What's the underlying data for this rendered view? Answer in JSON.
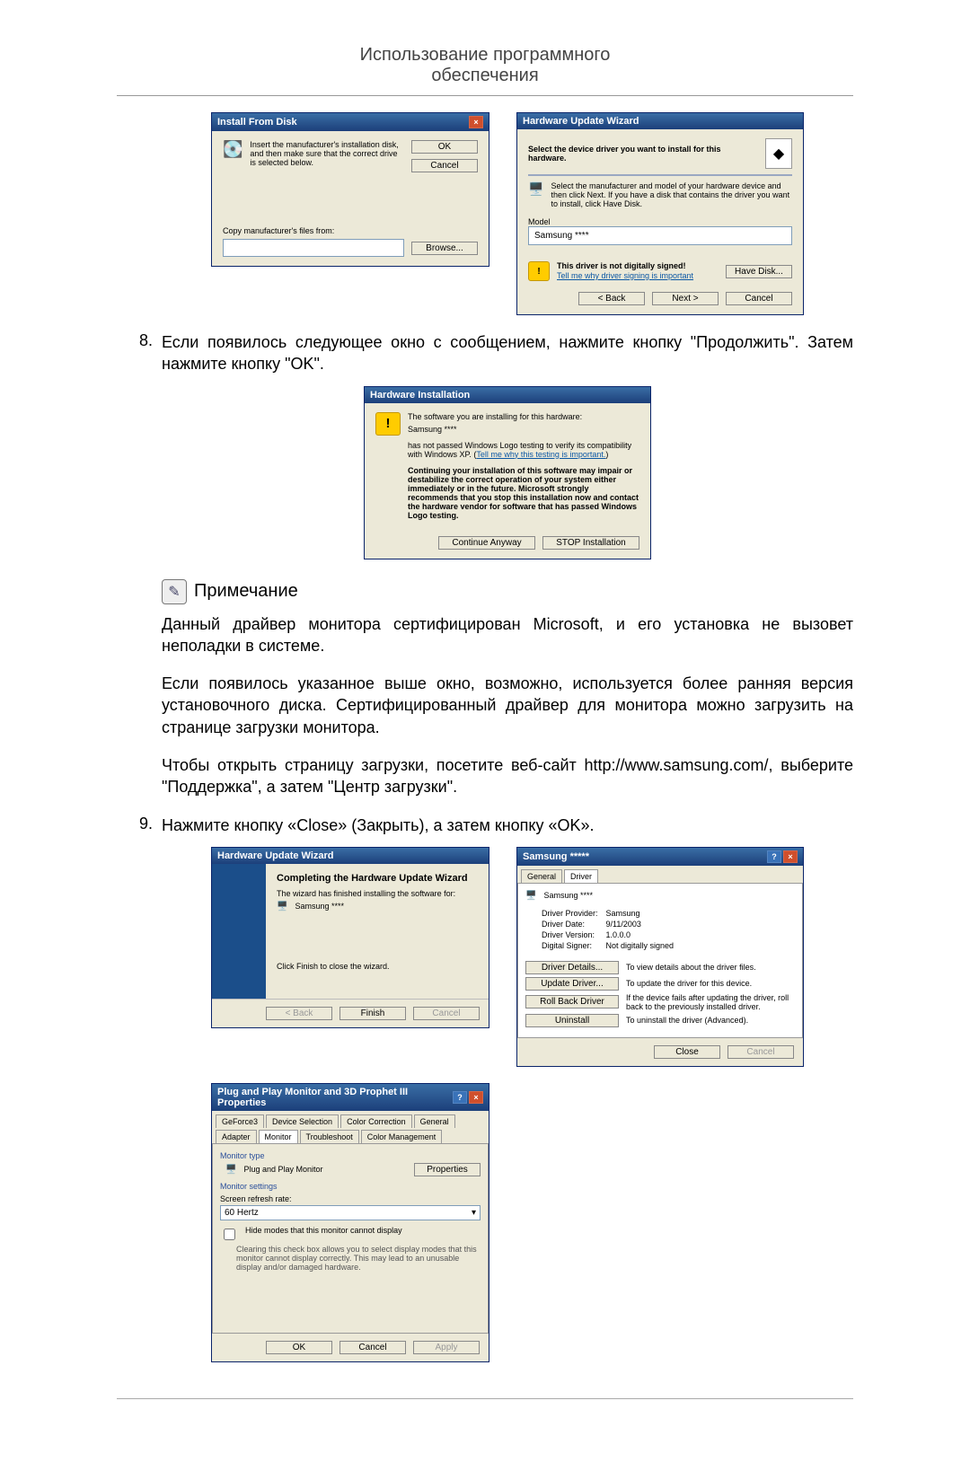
{
  "header": {
    "line1": "Использование программного",
    "line2": "обеспечения"
  },
  "step8": {
    "num": "8.",
    "text": "Если появилось следующее окно с сообщением, нажмите кнопку \"Продолжить\". Затем нажмите кнопку \"OK\"."
  },
  "step9": {
    "num": "9.",
    "text": "Нажмите кнопку «Close» (Закрыть), а затем кнопку «OK»."
  },
  "note": {
    "title": "Примечание"
  },
  "para1": "Данный драйвер монитора сертифицирован Microsoft, и его установка не вызовет неполадки в системе.",
  "para2": "Если появилось указанное выше окно, возможно, используется более ранняя версия установочного диска. Сертифицированный драйвер для монитора можно загрузить на странице загрузки монитора.",
  "para3": "Чтобы открыть страницу загрузки, посетите веб-сайт http://www.samsung.com/, выберите \"Поддержка\", а затем \"Центр загрузки\".",
  "dlg_install_from_disk": {
    "title": "Install From Disk",
    "instruction": "Insert the manufacturer's installation disk, and then make sure that the correct drive is selected below.",
    "copy_label": "Copy manufacturer's files from:",
    "ok": "OK",
    "cancel": "Cancel",
    "browse": "Browse..."
  },
  "dlg_hw_update": {
    "title": "Hardware Update Wizard",
    "heading": "Select the device driver you want to install for this hardware.",
    "instruction": "Select the manufacturer and model of your hardware device and then click Next. If you have a disk that contains the driver you want to install, click Have Disk.",
    "model_label": "Model",
    "model_value": "Samsung ****",
    "not_signed": "This driver is not digitally signed!",
    "tell_me": "Tell me why driver signing is important",
    "have_disk": "Have Disk...",
    "back": "< Back",
    "next": "Next >",
    "cancel": "Cancel"
  },
  "dlg_hw_install": {
    "title": "Hardware Installation",
    "line1": "The software you are installing for this hardware:",
    "device": "Samsung ****",
    "line2a": "has not passed Windows Logo testing to verify its compatibility with Windows XP. (",
    "line2_link": "Tell me why this testing is important.",
    "line2b": ")",
    "warn": "Continuing your installation of this software may impair or destabilize the correct operation of your system either immediately or in the future. Microsoft strongly recommends that you stop this installation now and contact the hardware vendor for software that has passed Windows Logo testing.",
    "continue": "Continue Anyway",
    "stop": "STOP Installation"
  },
  "dlg_completing": {
    "title": "Hardware Update Wizard",
    "heading": "Completing the Hardware Update Wizard",
    "line1": "The wizard has finished installing the software for:",
    "device": "Samsung ****",
    "click_finish": "Click Finish to close the wizard.",
    "back": "< Back",
    "finish": "Finish",
    "cancel": "Cancel"
  },
  "dlg_driver_props": {
    "title": "Samsung *****",
    "tab_general": "General",
    "tab_driver": "Driver",
    "device": "Samsung ****",
    "rows": {
      "provider_l": "Driver Provider:",
      "provider_v": "Samsung",
      "date_l": "Driver Date:",
      "date_v": "9/11/2003",
      "ver_l": "Driver Version:",
      "ver_v": "1.0.0.0",
      "signer_l": "Digital Signer:",
      "signer_v": "Not digitally signed"
    },
    "btn_details": "Driver Details...",
    "details_desc": "To view details about the driver files.",
    "btn_update": "Update Driver...",
    "update_desc": "To update the driver for this device.",
    "btn_rollback": "Roll Back Driver",
    "rollback_desc": "If the device fails after updating the driver, roll back to the previously installed driver.",
    "btn_uninstall": "Uninstall",
    "uninstall_desc": "To uninstall the driver (Advanced).",
    "close": "Close",
    "cancel": "Cancel"
  },
  "dlg_display_props": {
    "title": "Plug and Play Monitor and 3D Prophet III Properties",
    "tabs": {
      "geforce": "GeForce3",
      "devsel": "Device Selection",
      "colorcorr": "Color Correction",
      "general": "General",
      "adapter": "Adapter",
      "monitor": "Monitor",
      "trouble": "Troubleshoot",
      "colormgmt": "Color Management"
    },
    "monitor_type": "Monitor type",
    "pnp": "Plug and Play Monitor",
    "properties": "Properties",
    "monitor_settings": "Monitor settings",
    "refresh_label": "Screen refresh rate:",
    "refresh_value": "60 Hertz",
    "hide_check": "Hide modes that this monitor cannot display",
    "hide_desc": "Clearing this check box allows you to select display modes that this monitor cannot display correctly. This may lead to an unusable display and/or damaged hardware.",
    "ok": "OK",
    "cancel": "Cancel",
    "apply": "Apply"
  }
}
